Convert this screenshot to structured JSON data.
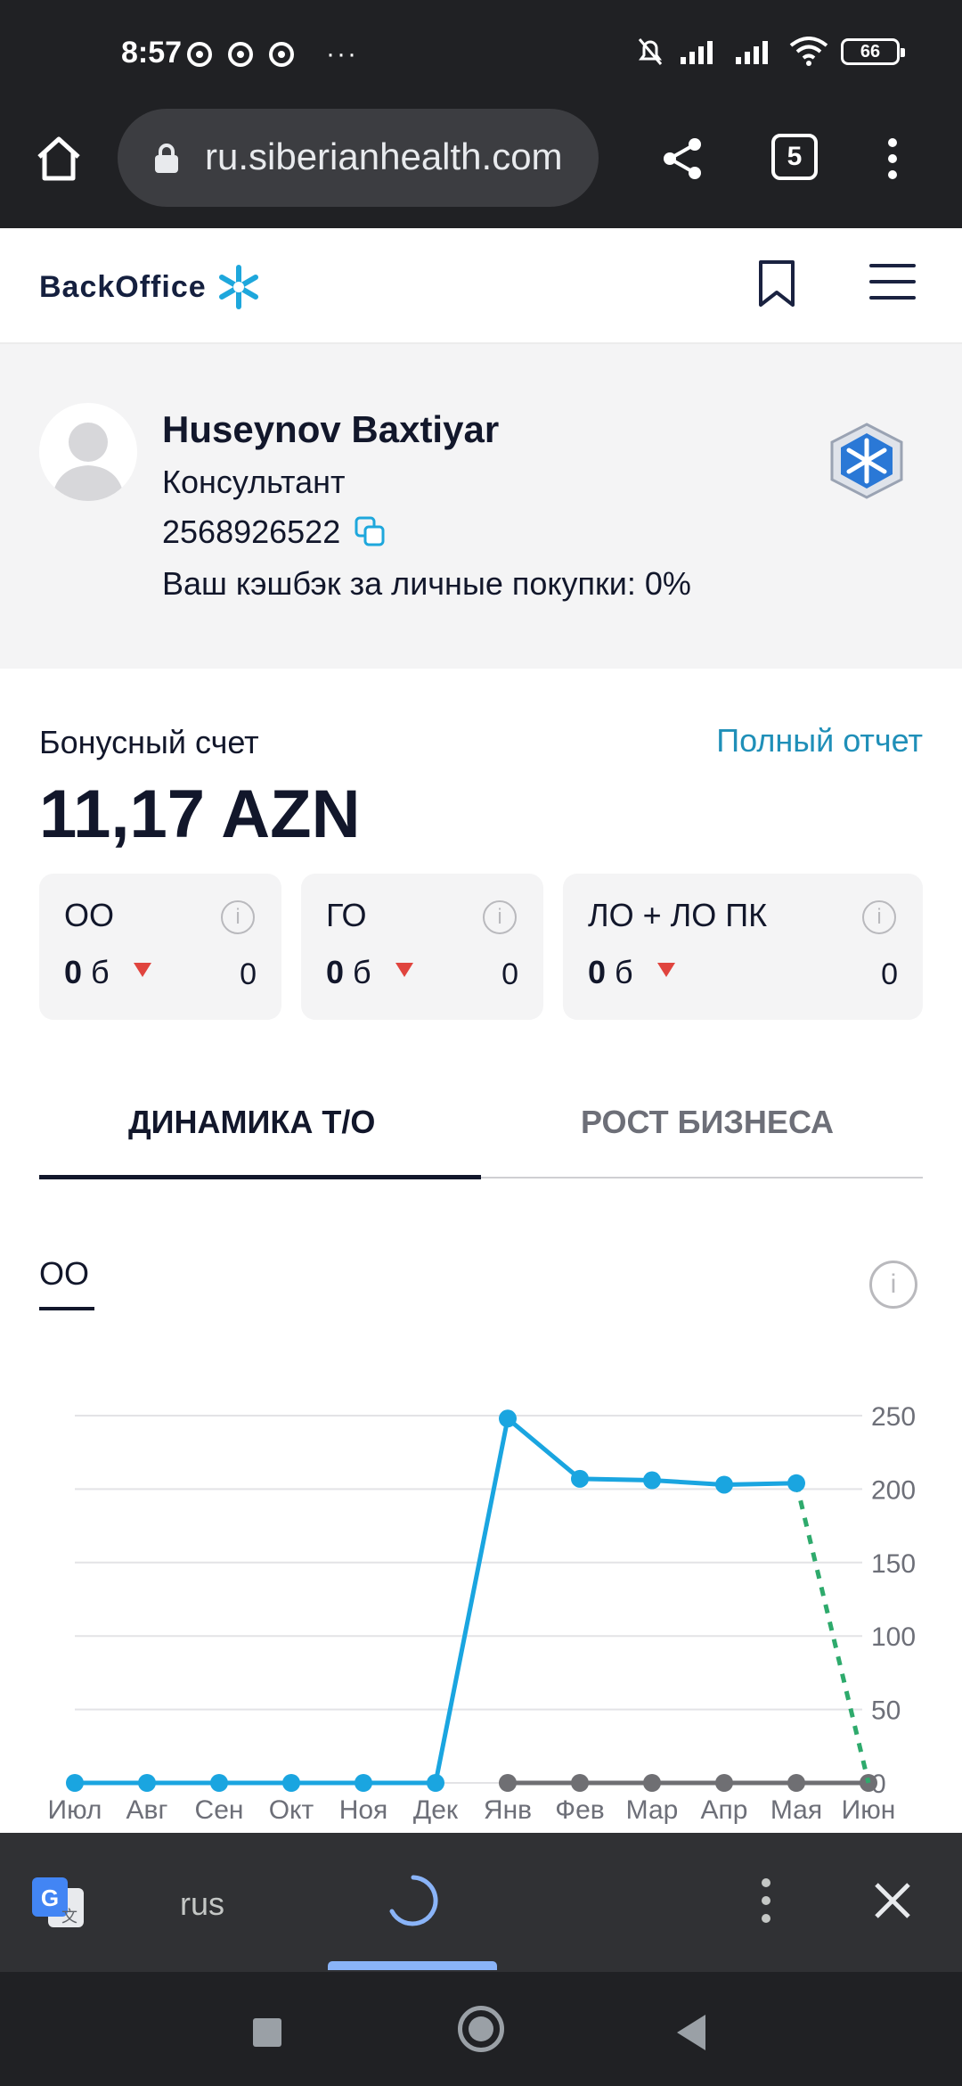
{
  "status_bar": {
    "time": "8:57",
    "battery": "66"
  },
  "browser": {
    "url": "ru.siberianhealth.com",
    "tab_count": "5"
  },
  "header": {
    "logo_text": "BackOffice"
  },
  "profile": {
    "name": "Huseynov Baxtiyar",
    "role": "Консультант",
    "id": "2568926522",
    "cashback": "Ваш кэшбэк за личные покупки: 0%"
  },
  "bonus": {
    "label": "Бонусный счет",
    "full_report": "Полный отчет",
    "value": "11,17 AZN"
  },
  "cards": [
    {
      "title": "ОО",
      "value": "0",
      "unit": "б",
      "right_value": "0"
    },
    {
      "title": "ГО",
      "value": "0",
      "unit": "б",
      "right_value": "0"
    },
    {
      "title": "ЛО + ЛО ПК",
      "value": "0",
      "unit": "б",
      "right_value": "0"
    }
  ],
  "tabs": [
    {
      "label": "ДИНАМИКА Т/О"
    },
    {
      "label": "РОСТ БИЗНЕСА"
    }
  ],
  "chart_tab": {
    "label": "ОО"
  },
  "chart_data": {
    "type": "line",
    "categories": [
      "Июл",
      "Авг",
      "Сен",
      "Окт",
      "Ноя",
      "Дек",
      "Янв",
      "Фев",
      "Мар",
      "Апр",
      "Мая",
      "Июн"
    ],
    "y_ticks": [
      "250",
      "200",
      "150",
      "100",
      "50",
      "0"
    ],
    "ylim": [
      0,
      250
    ],
    "series": [
      {
        "values": [
          0,
          0,
          0,
          0,
          0,
          0,
          248,
          207,
          206,
          203,
          204,
          0
        ],
        "color": "#1aa5e0"
      },
      {
        "values": [
          null,
          null,
          null,
          null,
          null,
          null,
          0,
          0,
          0,
          0,
          0,
          0
        ],
        "color": "#6f6f73"
      }
    ],
    "projection": {
      "from_index": 10,
      "to_index": 11,
      "color": "#2eaa6c",
      "style": "dashed"
    }
  },
  "translate_bar": {
    "language": "rus"
  }
}
